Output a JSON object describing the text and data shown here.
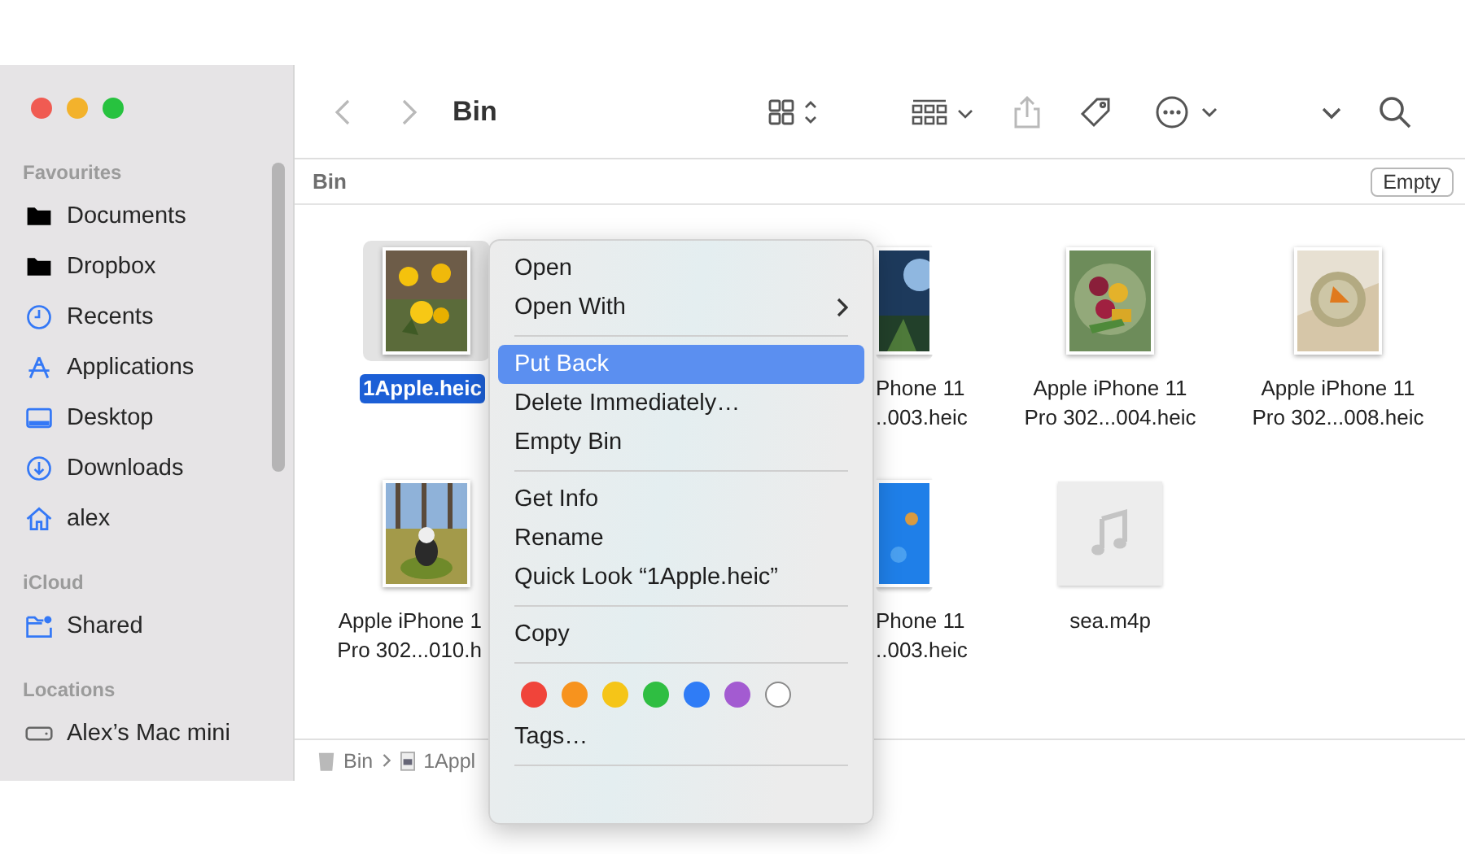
{
  "window": {
    "title": "Bin"
  },
  "toolbar": [
    {
      "kind": "back",
      "disabled": true
    },
    {
      "kind": "forward",
      "disabled": true
    },
    {
      "kind": "view",
      "disabled": false
    },
    {
      "kind": "group",
      "disabled": false
    },
    {
      "kind": "share",
      "disabled": true
    },
    {
      "kind": "tag",
      "disabled": false
    },
    {
      "kind": "more",
      "disabled": false
    },
    {
      "kind": "expand",
      "disabled": false
    },
    {
      "kind": "search",
      "disabled": false
    }
  ],
  "sidebar": [
    {
      "heading": "Favourites",
      "items": [
        {
          "label": "Documents",
          "kind": "folder"
        },
        {
          "label": "Dropbox",
          "kind": "folder"
        },
        {
          "label": "Recents",
          "kind": "clock"
        },
        {
          "label": "Applications",
          "kind": "apps"
        },
        {
          "label": "Desktop",
          "kind": "desktop"
        },
        {
          "label": "Downloads",
          "kind": "download"
        },
        {
          "label": "alex",
          "kind": "home"
        }
      ]
    },
    {
      "heading": "iCloud",
      "items": [
        {
          "label": "Shared",
          "kind": "shared"
        }
      ]
    },
    {
      "heading": "Locations",
      "items": [
        {
          "label": "Alex’s Mac mini",
          "kind": "drive"
        }
      ]
    }
  ],
  "path_header": {
    "title": "Bin",
    "button": "Empty"
  },
  "files": [
    [
      {
        "kind": "picture",
        "lines": [
          "1Apple.heic"
        ],
        "selected": true
      },
      {
        "kind": "picture",
        "lines": [
          "Phone 11",
          "..003.heic"
        ],
        "selected": false
      },
      {
        "kind": "picture",
        "lines": [
          "Apple iPhone 11",
          "Pro 302...004.heic"
        ],
        "selected": false
      },
      {
        "kind": "picture",
        "lines": [
          "Apple iPhone 11",
          "Pro 302...008.heic"
        ],
        "selected": false
      }
    ],
    [
      {
        "kind": "picture",
        "lines": [
          "Apple iPhone 1",
          "Pro 302...010.h"
        ],
        "selected": false
      },
      {
        "kind": "picture",
        "lines": [
          "Phone 11",
          "..003.heic"
        ],
        "selected": false
      },
      {
        "kind": "audio",
        "lines": [
          "sea.m4p"
        ],
        "selected": false
      }
    ]
  ],
  "path_bar": [
    {
      "label": "Bin",
      "kind": "trash"
    },
    {
      "label": "1Appl",
      "kind": "file"
    }
  ],
  "context_menu": [
    {
      "kind": "item",
      "label": "Open",
      "selected": false,
      "submenu": false
    },
    {
      "kind": "item",
      "label": "Open With",
      "selected": false,
      "submenu": true
    },
    {
      "kind": "separator"
    },
    {
      "kind": "item",
      "label": "Put Back",
      "selected": true,
      "submenu": false
    },
    {
      "kind": "item",
      "label": "Delete Immediately…",
      "selected": false,
      "submenu": false
    },
    {
      "kind": "item",
      "label": "Empty Bin",
      "selected": false,
      "submenu": false
    },
    {
      "kind": "separator"
    },
    {
      "kind": "item",
      "label": "Get Info",
      "selected": false,
      "submenu": false
    },
    {
      "kind": "item",
      "label": "Rename",
      "selected": false,
      "submenu": false
    },
    {
      "kind": "item",
      "label": "Quick Look “1Apple.heic”",
      "selected": false,
      "submenu": false
    },
    {
      "kind": "separator"
    },
    {
      "kind": "item",
      "label": "Copy",
      "selected": false,
      "submenu": false
    },
    {
      "kind": "separator"
    },
    {
      "kind": "colors",
      "colors": [
        {
          "color": "#f0443a"
        },
        {
          "color": "#f7931e"
        },
        {
          "color": "#f5c518"
        },
        {
          "color": "#2fbe42"
        },
        {
          "color": "#2f7cf6"
        },
        {
          "color": "#a35bd1"
        },
        {
          "color": "#ffffff"
        }
      ]
    },
    {
      "kind": "item",
      "label": "Tags…",
      "selected": false,
      "submenu": false
    },
    {
      "kind": "separator"
    }
  ]
}
